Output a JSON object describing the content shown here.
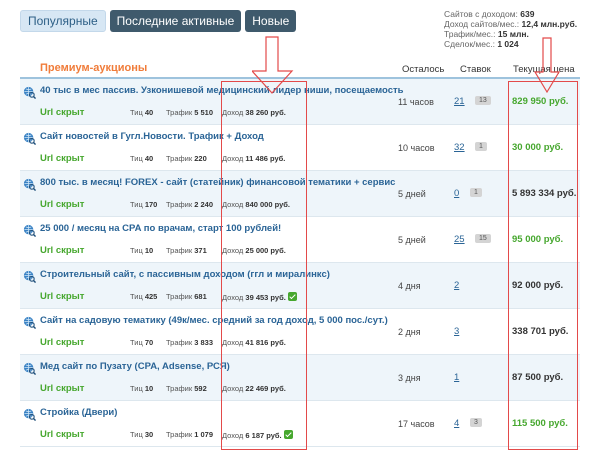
{
  "tabs": [
    {
      "label": "Популярные",
      "active": true
    },
    {
      "label": "Последние активные",
      "active": false
    },
    {
      "label": "Новые",
      "active": false
    }
  ],
  "stats": [
    {
      "label": "Сайтов с доходом:",
      "value": "639"
    },
    {
      "label": "Доход сайтов/мес.:",
      "value": "12,4 млн.руб."
    },
    {
      "label": "Трафик/мес.:",
      "value": "15 млн."
    },
    {
      "label": "Сделок/мес.:",
      "value": "1 024"
    }
  ],
  "columns": {
    "title": "Премиум-аукционы",
    "remaining": "Осталось",
    "bids": "Ставок",
    "price": "Текущая цена"
  },
  "lots": [
    {
      "title": "40 тыс в мес пассив. Узконишевой медицинский лидер ниши, посещаемость",
      "url": "Url скрыт",
      "tic_label": "Тиц",
      "tic": "40",
      "traffic_label": "Трафик",
      "traffic": "5 510",
      "income_label": "Доход",
      "income": "38 260 руб.",
      "verified": false,
      "time": "11 часов",
      "bids": "21",
      "new_bids": "13",
      "price": "829 950 руб.",
      "price_color": "green"
    },
    {
      "title": "Сайт новостей в Гугл.Новости. Трафик + Доход",
      "url": "Url скрыт",
      "tic_label": "Тиц",
      "tic": "40",
      "traffic_label": "Трафик",
      "traffic": "220",
      "income_label": "Доход",
      "income": "11 486 руб.",
      "verified": false,
      "time": "10 часов",
      "bids": "32",
      "new_bids": "1",
      "price": "30 000 руб.",
      "price_color": "green"
    },
    {
      "title": "800 тыс. в месяц! FOREX - сайт (статейник) финансовой тематики + сервис",
      "url": "Url скрыт",
      "tic_label": "Тиц",
      "tic": "170",
      "traffic_label": "Трафик",
      "traffic": "2 240",
      "income_label": "Доход",
      "income": "840 000 руб.",
      "verified": false,
      "time": "5 дней",
      "bids": "0",
      "new_bids": "1",
      "price": "5 893 334 руб.",
      "price_color": "dark"
    },
    {
      "title": "25 000 / месяц на CPA по врачам, старт 100 рублей!",
      "url": "Url скрыт",
      "tic_label": "Тиц",
      "tic": "10",
      "traffic_label": "Трафик",
      "traffic": "371",
      "income_label": "Доход",
      "income": "25 000 руб.",
      "verified": false,
      "time": "5 дней",
      "bids": "25",
      "new_bids": "15",
      "price": "95 000 руб.",
      "price_color": "green"
    },
    {
      "title": "Строительный сайт, с пассивным доходом (ггл и миралинкс)",
      "url": "Url скрыт",
      "tic_label": "Тиц",
      "tic": "425",
      "traffic_label": "Трафик",
      "traffic": "681",
      "income_label": "Доход",
      "income": "39 453 руб.",
      "verified": true,
      "time": "4 дня",
      "bids": "2",
      "new_bids": "",
      "price": "92 000 руб.",
      "price_color": "dark"
    },
    {
      "title": "Сайт на садовую тематику (49к/мес. средний за год доход, 5 000 пос./сут.)",
      "url": "Url скрыт",
      "tic_label": "Тиц",
      "tic": "70",
      "traffic_label": "Трафик",
      "traffic": "3 833",
      "income_label": "Доход",
      "income": "41 816 руб.",
      "verified": false,
      "time": "2 дня",
      "bids": "3",
      "new_bids": "",
      "price": "338 701 руб.",
      "price_color": "dark"
    },
    {
      "title": "Мед сайт по Пузату (CPA, Adsense, РСЯ)",
      "url": "Url скрыт",
      "tic_label": "Тиц",
      "tic": "10",
      "traffic_label": "Трафик",
      "traffic": "592",
      "income_label": "Доход",
      "income": "22 469 руб.",
      "verified": false,
      "time": "3 дня",
      "bids": "1",
      "new_bids": "",
      "price": "87 500 руб.",
      "price_color": "dark"
    },
    {
      "title": "Стройка (Двери)",
      "url": "Url скрыт",
      "tic_label": "Тиц",
      "tic": "30",
      "traffic_label": "Трафик",
      "traffic": "1 079",
      "income_label": "Доход",
      "income": "6 187 руб.",
      "verified": true,
      "time": "17 часов",
      "bids": "4",
      "new_bids": "3",
      "price": "115 500 руб.",
      "price_color": "green"
    }
  ],
  "icon": "globe-search-icon",
  "colors": {
    "link": "#2a6496",
    "green": "#46a72e",
    "orange": "#f07c3a",
    "annotation": "#e34a4a"
  }
}
